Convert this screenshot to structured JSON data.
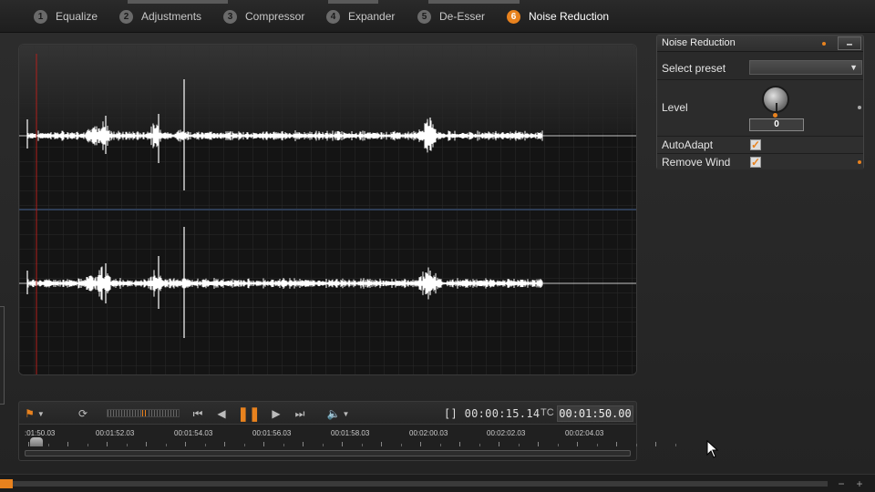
{
  "tabs": [
    {
      "num": "1",
      "label": "Equalize"
    },
    {
      "num": "2",
      "label": "Adjustments"
    },
    {
      "num": "3",
      "label": "Compressor"
    },
    {
      "num": "4",
      "label": "Expander"
    },
    {
      "num": "5",
      "label": "De-Esser"
    },
    {
      "num": "6",
      "label": "Noise Reduction",
      "active": true
    }
  ],
  "transport": {
    "duration_prefix": "[]",
    "duration": "00:00:15.14",
    "tc_label": "TC",
    "timecode": "00:01:50.00",
    "playing": true
  },
  "timeline": {
    "labels": [
      ":01:50.03",
      "00:01:52.03",
      "00:01:54.03",
      "00:01:56.03",
      "00:01:58.03",
      "00:02:00.03",
      "00:02:02.03",
      "00:02:04.03"
    ]
  },
  "panel": {
    "title": "Noise Reduction",
    "select_preset_label": "Select preset",
    "selected_preset": "",
    "level_label": "Level",
    "level_value": "0",
    "autoadapt_label": "AutoAdapt",
    "autoadapt_checked": true,
    "remove_wind_label": "Remove Wind",
    "remove_wind_checked": true
  },
  "colors": {
    "accent": "#e8821e",
    "waveform": "#ffffff",
    "background": "#1b1b1b"
  },
  "icons": [
    "marker-icon",
    "loop-icon",
    "skip-start-icon",
    "frame-back-icon",
    "pause-icon",
    "frame-forward-icon",
    "skip-end-icon",
    "volume-icon",
    "checkmark-icon",
    "mouse-cursor-icon"
  ]
}
